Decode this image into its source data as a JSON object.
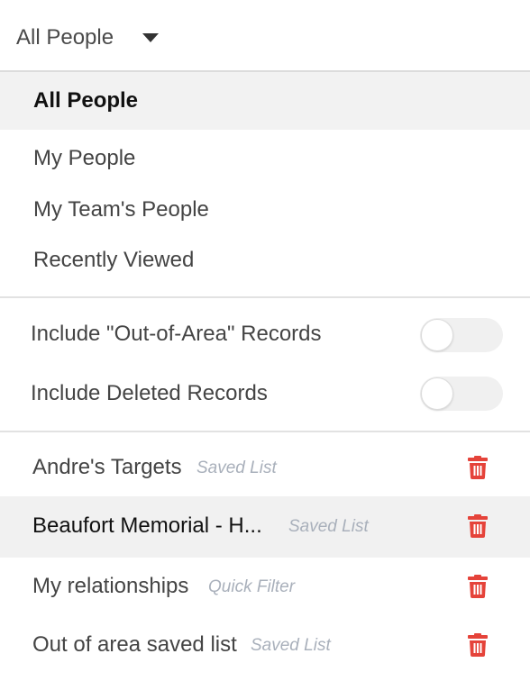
{
  "dropdown": {
    "selected_label": "All People"
  },
  "scope_options": [
    {
      "label": "All People"
    },
    {
      "label": "My People"
    },
    {
      "label": "My Team's People"
    },
    {
      "label": "Recently Viewed"
    }
  ],
  "toggles": [
    {
      "label": "Include \"Out-of-Area\" Records",
      "on": false
    },
    {
      "label": "Include Deleted Records",
      "on": false
    }
  ],
  "saved_lists": [
    {
      "name": "Andre's Targets",
      "type": "Saved List"
    },
    {
      "name": "Beaufort Memorial - H...",
      "type": "Saved List"
    },
    {
      "name": "My relationships",
      "type": "Quick Filter"
    },
    {
      "name": "Out of area saved list",
      "type": "Saved List"
    }
  ],
  "colors": {
    "trash_icon": "#e5433a",
    "selected_bg": "#f2f2f2",
    "type_tag": "#a9b0bb"
  }
}
